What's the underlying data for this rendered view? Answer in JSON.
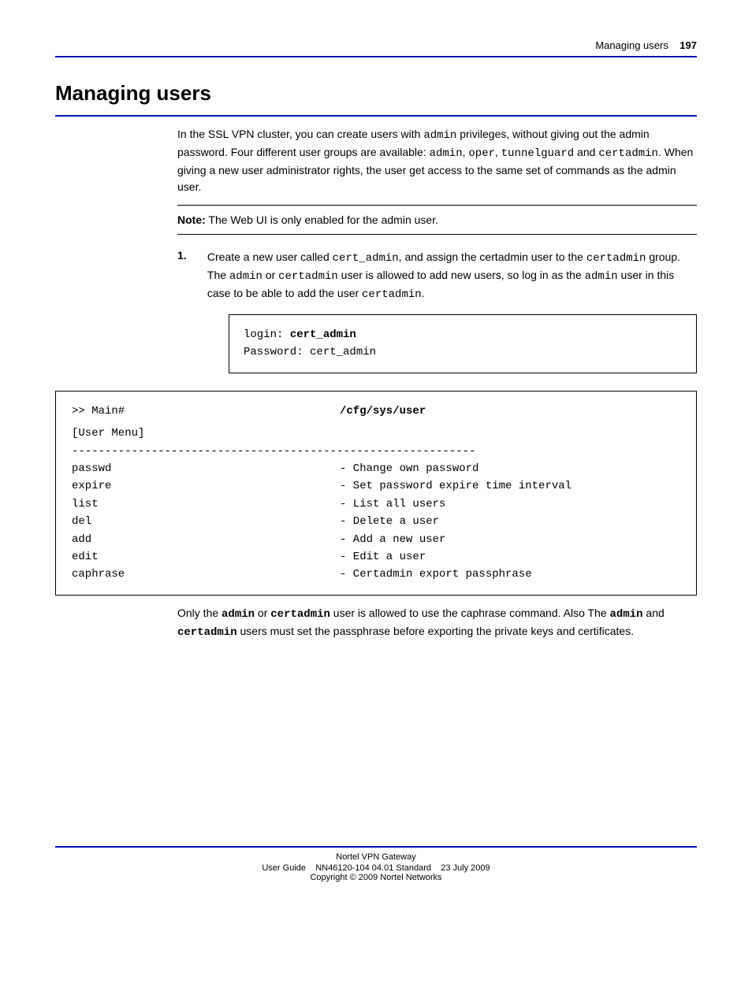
{
  "header": {
    "section": "Managing users",
    "pagenum": "197"
  },
  "title": "Managing users",
  "intro": {
    "p1_a": "In the SSL VPN cluster, you can create users with ",
    "p1_b": " privileges, without giving out the admin password. Four different user groups are available: ",
    "p1_c": ", ",
    "p1_d": ", ",
    "p1_e": " and ",
    "p1_f": ". When giving a new user administrator rights, the user get access to the same set of commands as the admin user.",
    "admin": "admin",
    "oper": "oper",
    "tunnelguard": "tunnelguard",
    "certadmin": "certadmin"
  },
  "note": {
    "label": "Note:",
    "text": " The Web UI is only enabled for the admin user."
  },
  "step1": {
    "num": "1.",
    "t1": "Create a new user called ",
    "cert_admin": "cert_admin",
    "t2": ", and assign the certadmin user to the ",
    "certadmin": "certadmin",
    "t3": " group. The ",
    "admin": "admin",
    "t4": " or ",
    "t5": " user is allowed to add new users, so log in as the ",
    "t6": " user in this case to be able to add the user ",
    "t7": "."
  },
  "login": {
    "login_label": "login: ",
    "login_val": "cert_admin",
    "pw_label": "Password:  ",
    "pw_val": "cert_admin"
  },
  "menu": {
    "prompt": ">> Main#",
    "path": "/cfg/sys/user",
    "heading": "[User Menu]",
    "dashes": "-------------------------------------------------------------",
    "items": [
      {
        "cmd": "passwd",
        "desc": "- Change own password"
      },
      {
        "cmd": "expire",
        "desc": "- Set password expire time interval"
      },
      {
        "cmd": "list",
        "desc": "- List all users"
      },
      {
        "cmd": "del",
        "desc": "- Delete a user"
      },
      {
        "cmd": "add",
        "desc": "- Add a new user"
      },
      {
        "cmd": "edit",
        "desc": "- Edit a user"
      },
      {
        "cmd": "caphrase",
        "desc": "- Certadmin export passphrase"
      }
    ]
  },
  "trailing": {
    "t1": "Only the ",
    "admin1": "admin",
    "t2": " or ",
    "certadmin1": "certadmin",
    "t3": " user is allowed to use the caphrase command. Also The ",
    "admin2": "admin",
    "t4": " and ",
    "certadmin2": "certadmin",
    "t5": " users must set the passphrase before exporting the private keys and certificates."
  },
  "footer": {
    "line1": "Nortel VPN Gateway",
    "line2_a": "User Guide",
    "line2_b": "NN46120-104 04.01 Standard",
    "line2_c": "23 July 2009",
    "copyright": "Copyright © 2009 Nortel Networks"
  }
}
